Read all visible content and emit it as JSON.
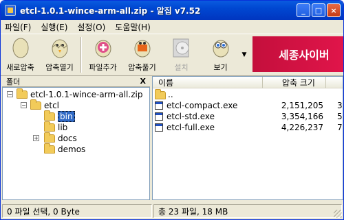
{
  "window": {
    "title": "etcl-1.0.1-wince-arm-all.zip - 알집 v7.52"
  },
  "title_buttons": [
    "_",
    "□",
    "×"
  ],
  "menu": [
    "파일(F)",
    "실행(E)",
    "설정(O)",
    "도움말(H)"
  ],
  "toolbar": {
    "new_zip": "새로압축",
    "open_zip": "압축열기",
    "add_files": "파일추가",
    "extract": "압축풀기",
    "install": "설치",
    "view": "보기",
    "more_arrow": "▼"
  },
  "banner": "세종사이버",
  "folder_pane": {
    "header": "폴더",
    "close": "X",
    "tree": [
      {
        "label": "etcl-1.0.1-wince-arm-all.zip",
        "pm": "−"
      },
      {
        "label": "etcl",
        "pm": "−"
      },
      {
        "label": "bin",
        "pm": ""
      },
      {
        "label": "lib",
        "pm": ""
      },
      {
        "label": "docs",
        "pm": "+"
      },
      {
        "label": "demos",
        "pm": ""
      }
    ]
  },
  "file_pane": {
    "columns": [
      "이름",
      "압축 크기",
      ""
    ],
    "rows": [
      {
        "name": "..",
        "size": "",
        "extra": ""
      },
      {
        "name": "etcl-compact.exe",
        "size": "2,151,205",
        "extra": "3"
      },
      {
        "name": "etcl-std.exe",
        "size": "3,354,166",
        "extra": "5"
      },
      {
        "name": "etcl-full.exe",
        "size": "4,226,237",
        "extra": "7"
      }
    ]
  },
  "status": {
    "left": "0 파일 선택,  0 Byte",
    "right": "총 23 파일,    18 MB"
  }
}
